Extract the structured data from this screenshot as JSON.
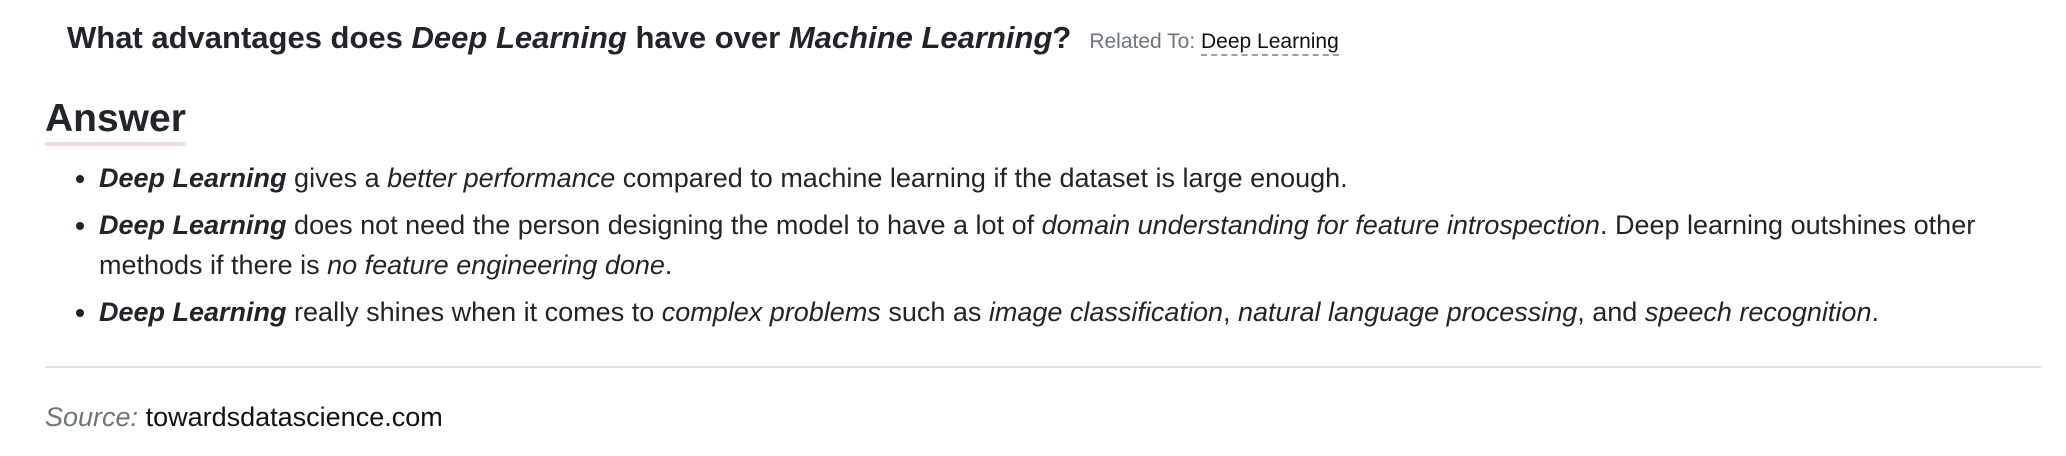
{
  "question": {
    "prefix": "What advantages does ",
    "term1": "Deep Learning",
    "middle": " have over ",
    "term2": "Machine Learning",
    "suffix": "?",
    "related_label": "Related To: ",
    "related_link": "Deep Learning"
  },
  "answer": {
    "heading": "Answer",
    "items": [
      {
        "parts": [
          {
            "style": "bi",
            "text": "Deep Learning"
          },
          {
            "style": "n",
            "text": " gives a "
          },
          {
            "style": "i",
            "text": "better performance"
          },
          {
            "style": "n",
            "text": " compared to machine learning if the dataset is large enough."
          }
        ]
      },
      {
        "parts": [
          {
            "style": "bi",
            "text": "Deep Learning"
          },
          {
            "style": "n",
            "text": " does not need the person designing the model to have a lot of "
          },
          {
            "style": "i",
            "text": "domain understanding for feature introspection"
          },
          {
            "style": "n",
            "text": ". Deep learning outshines other methods if there is "
          },
          {
            "style": "i",
            "text": "no feature engineering done"
          },
          {
            "style": "n",
            "text": "."
          }
        ]
      },
      {
        "parts": [
          {
            "style": "bi",
            "text": "Deep Learning"
          },
          {
            "style": "n",
            "text": " really shines when it comes to "
          },
          {
            "style": "i",
            "text": "complex problems"
          },
          {
            "style": "n",
            "text": " such as "
          },
          {
            "style": "i",
            "text": "image classification"
          },
          {
            "style": "n",
            "text": ", "
          },
          {
            "style": "i",
            "text": "natural language processing"
          },
          {
            "style": "n",
            "text": ", and "
          },
          {
            "style": "i",
            "text": "speech recognition"
          },
          {
            "style": "n",
            "text": "."
          }
        ]
      }
    ]
  },
  "source": {
    "label": "Source:",
    "link": "towardsdatascience.com"
  }
}
